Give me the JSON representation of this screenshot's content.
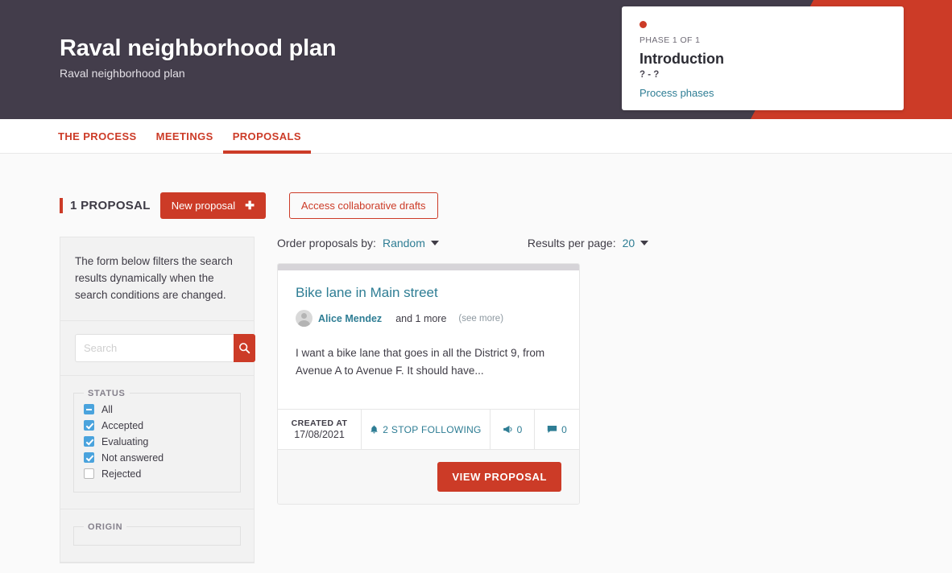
{
  "hero": {
    "title": "Raval neighborhood plan",
    "subtitle": "Raval neighborhood plan"
  },
  "phase_card": {
    "step_label": "PHASE 1 OF 1",
    "title": "Introduction",
    "dates": "? - ?",
    "link_label": "Process phases"
  },
  "tabs": [
    {
      "label": "THE PROCESS",
      "active": false
    },
    {
      "label": "MEETINGS",
      "active": false
    },
    {
      "label": "PROPOSALS",
      "active": true
    }
  ],
  "section": {
    "count_label": "1 PROPOSAL",
    "new_proposal_label": "New proposal",
    "new_proposal_icon": "plus-icon",
    "drafts_label": "Access collaborative drafts"
  },
  "sidebar": {
    "intro": "The form below filters the search results dynamically when the search conditions are changed.",
    "search_placeholder": "Search",
    "search_value": "",
    "search_icon": "search-icon",
    "status": {
      "legend": "STATUS",
      "options": [
        {
          "label": "All",
          "state": "indeterminate"
        },
        {
          "label": "Accepted",
          "state": "checked"
        },
        {
          "label": "Evaluating",
          "state": "checked"
        },
        {
          "label": "Not answered",
          "state": "checked"
        },
        {
          "label": "Rejected",
          "state": "unchecked"
        }
      ]
    },
    "origin": {
      "legend": "ORIGIN"
    }
  },
  "order_bar": {
    "order_label": "Order proposals by:",
    "order_value": "Random",
    "rpp_label": "Results per page:",
    "rpp_value": "20"
  },
  "proposal": {
    "title": "Bike lane in Main street",
    "author": "Alice Mendez",
    "author_more": "and 1 more",
    "see_more": "(see more)",
    "excerpt": "I want a bike lane that goes in all the District 9, from Avenue A to Avenue F. It should have...",
    "created_key": "CREATED AT",
    "created_value": "17/08/2021",
    "follow_label": "2 STOP FOLLOWING",
    "follow_icon": "bell-icon",
    "endorsements_count": "0",
    "endorsements_icon": "megaphone-icon",
    "comments_count": "0",
    "comments_icon": "comment-icon",
    "view_label": "VIEW PROPOSAL"
  },
  "colors": {
    "accent_red": "#cc3b27",
    "hero_dark": "#433d4b",
    "link_teal": "#2e7d94",
    "checkbox_blue": "#4aa3dd"
  }
}
